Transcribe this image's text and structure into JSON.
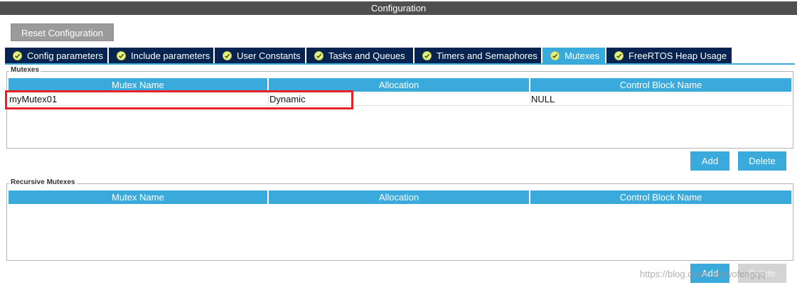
{
  "window": {
    "title": "Configuration"
  },
  "toolbar": {
    "reset_label": "Reset Configuration"
  },
  "tabs": [
    {
      "label": "Config parameters",
      "active": false
    },
    {
      "label": "Include parameters",
      "active": false
    },
    {
      "label": "User Constants",
      "active": false
    },
    {
      "label": "Tasks and Queues",
      "active": false
    },
    {
      "label": "Timers and Semaphores",
      "active": false
    },
    {
      "label": "Mutexes",
      "active": true
    },
    {
      "label": "FreeRTOS Heap Usage",
      "active": false
    }
  ],
  "mutexes": {
    "legend": "Mutexes",
    "columns": [
      "Mutex Name",
      "Allocation",
      "Control Block Name"
    ],
    "rows": [
      {
        "name": "myMutex01",
        "allocation": "Dynamic",
        "control_block": "NULL"
      }
    ],
    "add_label": "Add",
    "delete_label": "Delete"
  },
  "recursive_mutexes": {
    "legend": "Recursive Mutexes",
    "columns": [
      "Mutex Name",
      "Allocation",
      "Control Block Name"
    ],
    "rows": [],
    "add_label": "Add",
    "delete_label": "Delete"
  },
  "watermark": "https://blog.csdn.net/wofengqq",
  "colors": {
    "tab_bg": "#06244f",
    "accent": "#3aaadc",
    "title_bg": "#4f4f4f",
    "highlight": "#e8242b"
  }
}
